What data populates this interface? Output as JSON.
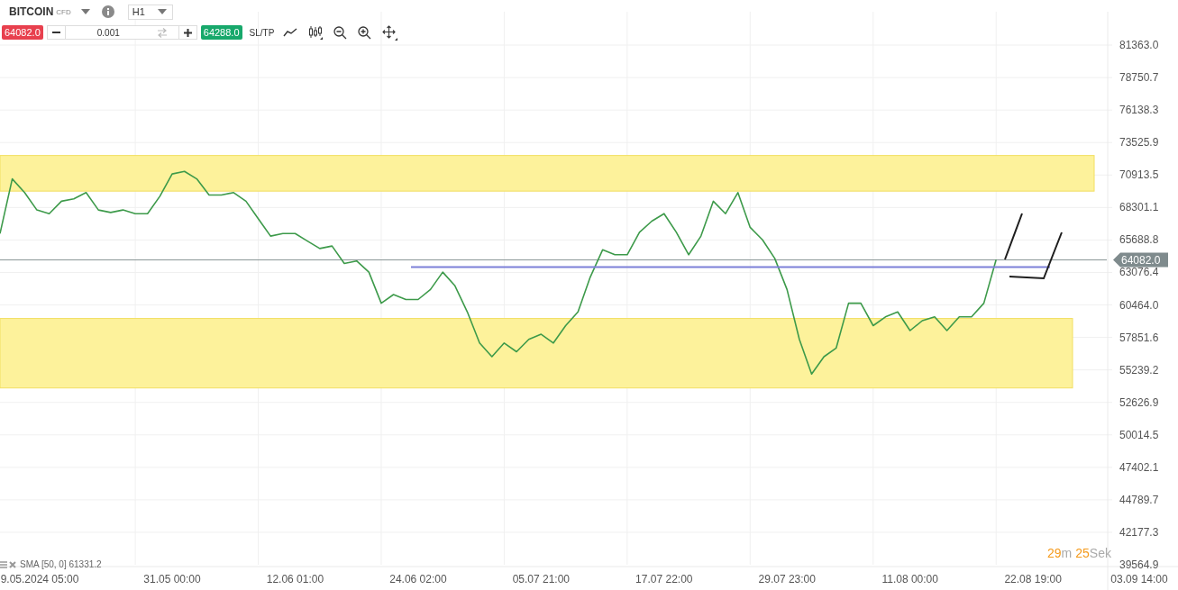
{
  "symbol": {
    "name": "BITCOIN",
    "type": "CFD"
  },
  "timeframe": "H1",
  "trade": {
    "sell_price": "64082.0",
    "quantity": "0.001",
    "buy_price": "64288.0",
    "sltp": "SL/TP"
  },
  "tools": [
    {
      "kind": "line"
    },
    {
      "kind": "candles"
    },
    {
      "kind": "zoom-out"
    },
    {
      "kind": "zoom-in"
    },
    {
      "kind": "move"
    }
  ],
  "chart": {
    "indicator": "SMA [50, 0] 61331.2",
    "countdown": {
      "minutes": "29",
      "minutes_unit": "m",
      "seconds": "25",
      "seconds_unit": "Sek"
    },
    "chart_data": {
      "type": "line",
      "ylim": [
        39564.9,
        84044
      ],
      "grid": true,
      "categories": [
        null,
        null,
        null,
        "9.05.2024 05:00",
        null,
        null,
        null,
        null,
        null,
        null,
        null,
        null,
        null,
        null,
        "31.05 00:00",
        null,
        null,
        null,
        null,
        null,
        null,
        null,
        null,
        null,
        "12.06 01:00",
        null,
        null,
        null,
        null,
        null,
        null,
        null,
        null,
        null,
        "24.06 02:00",
        null,
        null,
        null,
        null,
        null,
        null,
        null,
        null,
        null,
        "05.07 21:00",
        null,
        null,
        null,
        null,
        null,
        null,
        null,
        null,
        null,
        "17.07 22:00",
        null,
        null,
        null,
        null,
        null,
        null,
        null,
        null,
        null,
        "29.07 23:00",
        null,
        null,
        null,
        null,
        null,
        null,
        null,
        null,
        null,
        "11.08 00:00",
        null,
        null,
        null,
        null,
        null,
        null,
        null,
        null,
        null,
        "22.08 19:00",
        null,
        null,
        null,
        null,
        null,
        null,
        null,
        null,
        null,
        "03.09 14:00"
      ],
      "yticks": [
        {
          "value": 81363.0,
          "label": "81363.0"
        },
        {
          "value": 78750.7,
          "label": "78750.7"
        },
        {
          "value": 76138.3,
          "label": "76138.3"
        },
        {
          "value": 73525.9,
          "label": "73525.9"
        },
        {
          "value": 70913.5,
          "label": "70913.5"
        },
        {
          "value": 68301.1,
          "label": "68301.1"
        },
        {
          "value": 65688.8,
          "label": "65688.8"
        },
        {
          "value": 63076.4,
          "label": "63076.4"
        },
        {
          "value": 60464.0,
          "label": "60464.0"
        },
        {
          "value": 57851.6,
          "label": "57851.6"
        },
        {
          "value": 55239.2,
          "label": "55239.2"
        },
        {
          "value": 52626.9,
          "label": "52626.9"
        },
        {
          "value": 50014.5,
          "label": "50014.5"
        },
        {
          "value": 47402.1,
          "label": "47402.1"
        },
        {
          "value": 44789.7,
          "label": "44789.7"
        },
        {
          "value": 42177.3,
          "label": "42177.3"
        },
        {
          "value": 39564.9,
          "label": "39564.9"
        }
      ],
      "series": [
        {
          "color": "#3d9a4a",
          "values": [
            66200,
            70600,
            69500,
            68100,
            67800,
            68800,
            69000,
            69500,
            68100,
            67900,
            68100,
            67800,
            67800,
            69200,
            71000,
            71200,
            70600,
            69300,
            69300,
            69500,
            68800,
            67400,
            66000,
            66200,
            66200,
            65600,
            65000,
            65200,
            63800,
            64000,
            63100,
            60600,
            61300,
            60900,
            60900,
            61700,
            63100,
            62000,
            59900,
            57400,
            56300,
            57400,
            56700,
            57700,
            58100,
            57400,
            58800,
            59900,
            62700,
            64900,
            64500,
            64500,
            66300,
            67200,
            67800,
            66300,
            64500,
            66000,
            68800,
            67800,
            69500,
            66700,
            65700,
            64200,
            61700,
            57700,
            54900,
            56300,
            57000,
            60600,
            60600,
            58800,
            59500,
            59900,
            58400,
            59200,
            59500,
            58400,
            59500,
            59500,
            60600,
            64100,
            null,
            null,
            null,
            null,
            null,
            null,
            null,
            null,
            null,
            null,
            null,
            null,
            null
          ]
        }
      ],
      "bands": [
        {
          "axis": "y",
          "from": 69616,
          "to": 72481
        },
        {
          "axis": "y",
          "from": 53785,
          "to": 59373
        }
      ],
      "ref_lines": [
        {
          "axis": "y",
          "value": 64082,
          "label": "64082.0"
        },
        {
          "axis": "y",
          "value": 63500
        }
      ]
    }
  }
}
